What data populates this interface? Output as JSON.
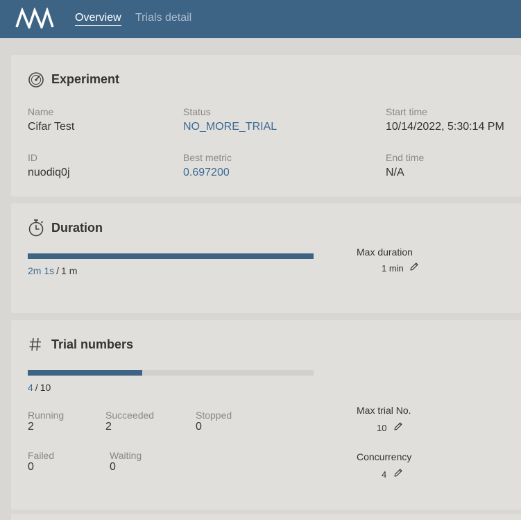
{
  "nav": {
    "overview": "Overview",
    "trials_detail": "Trials detail"
  },
  "experiment": {
    "title": "Experiment",
    "name_label": "Name",
    "name": "Cifar Test",
    "status_label": "Status",
    "status": "NO_MORE_TRIAL",
    "start_label": "Start time",
    "start": "10/14/2022, 5:30:14 PM",
    "id_label": "ID",
    "id": "nuodiq0j",
    "best_label": "Best metric",
    "best": "0.697200",
    "end_label": "End time",
    "end": "N/A"
  },
  "duration": {
    "title": "Duration",
    "current": "2m 1s",
    "sep": "/",
    "max_text": "1 m",
    "progress": 1.0,
    "max_label": "Max duration",
    "max_value": "1 min"
  },
  "trials": {
    "title": "Trial numbers",
    "current": "4",
    "sep": "/",
    "max": "10",
    "progress": 0.4,
    "running_label": "Running",
    "running": "2",
    "succeeded_label": "Succeeded",
    "succeeded": "2",
    "stopped_label": "Stopped",
    "stopped": "0",
    "failed_label": "Failed",
    "failed": "0",
    "waiting_label": "Waiting",
    "waiting": "0",
    "max_trial_label": "Max trial No.",
    "max_trial": "10",
    "concurrency_label": "Concurrency",
    "concurrency": "4"
  },
  "icons": {
    "logo": "nni-logo",
    "experiment": "gauge-icon",
    "duration": "stopwatch-icon",
    "trials": "hash-icon",
    "edit": "pencil-icon"
  },
  "colors": {
    "header": "#3e6485",
    "accent": "#3c6a93",
    "card": "#e1dfdc",
    "background": "#d9d7d4"
  }
}
